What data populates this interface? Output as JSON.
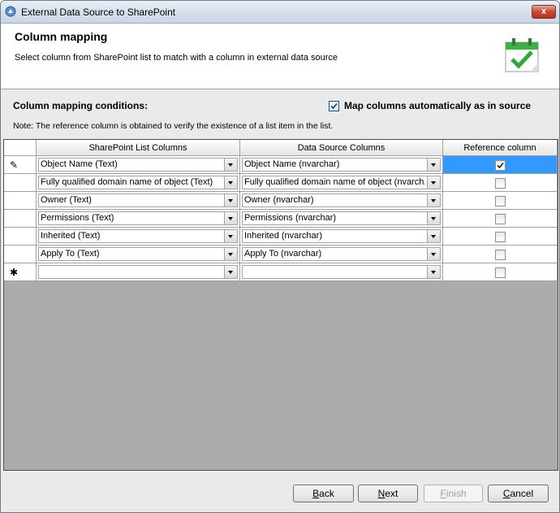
{
  "window": {
    "title": "External Data Source to SharePoint",
    "close_label": "x"
  },
  "header": {
    "title": "Column mapping",
    "subtitle": "Select column from SharePoint list to match with a column in external data source",
    "icon": "calendar-check-icon"
  },
  "conditions": {
    "label": "Column mapping conditions:",
    "auto_map_label": "Map columns automatically as in source",
    "auto_map_checked": true,
    "note": "Note: The reference column is obtained to verify the existence of a list item in the list."
  },
  "grid": {
    "columns": [
      "SharePoint List Columns",
      "Data Source Columns",
      "Reference column"
    ],
    "rows": [
      {
        "marker": "edit",
        "sharepoint": "Object Name (Text)",
        "source": "Object Name (nvarchar)",
        "reference": true,
        "selected": true
      },
      {
        "marker": "",
        "sharepoint": "Fully qualified domain name of object (Text)",
        "source": "Fully qualified domain name of object (nvarch...",
        "reference": false,
        "selected": false
      },
      {
        "marker": "",
        "sharepoint": "Owner (Text)",
        "source": "Owner (nvarchar)",
        "reference": false,
        "selected": false
      },
      {
        "marker": "",
        "sharepoint": "Permissions (Text)",
        "source": "Permissions (nvarchar)",
        "reference": false,
        "selected": false
      },
      {
        "marker": "",
        "sharepoint": "Inherited (Text)",
        "source": "Inherited (nvarchar)",
        "reference": false,
        "selected": false
      },
      {
        "marker": "",
        "sharepoint": "Apply To (Text)",
        "source": "Apply To (nvarchar)",
        "reference": false,
        "selected": false
      },
      {
        "marker": "new",
        "sharepoint": "",
        "source": "",
        "reference": false,
        "selected": false
      }
    ]
  },
  "footer": {
    "back": {
      "key": "B",
      "rest": "ack"
    },
    "next": {
      "key": "N",
      "rest": "ext"
    },
    "finish": {
      "key": "F",
      "rest": "inish"
    },
    "cancel": {
      "key": "C",
      "rest": "ancel"
    }
  }
}
